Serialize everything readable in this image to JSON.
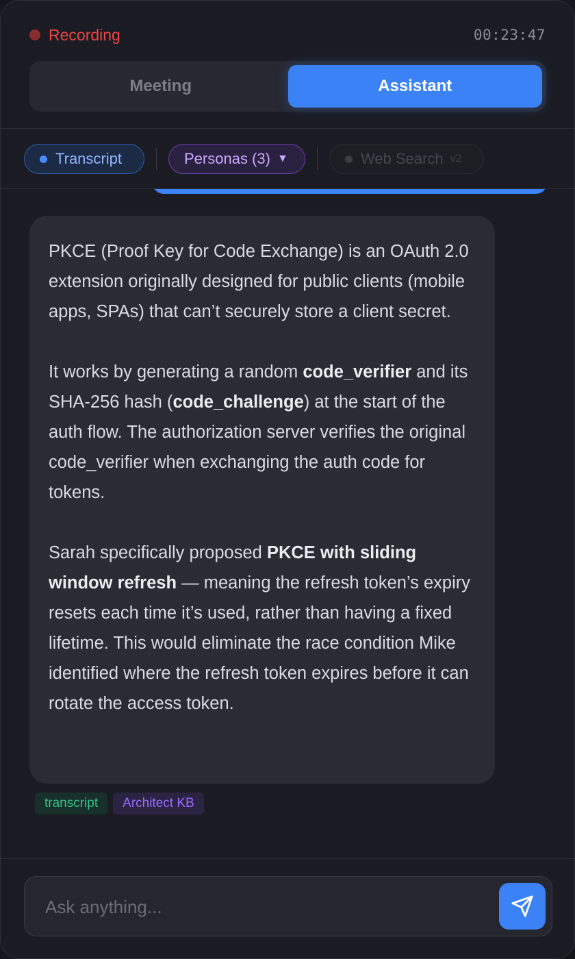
{
  "header": {
    "status_label": "Recording",
    "timer": "00:23:47"
  },
  "tabs": [
    {
      "label": "Meeting",
      "active": false
    },
    {
      "label": "Assistant",
      "active": true
    }
  ],
  "filters": {
    "transcript": "Transcript",
    "personas": "Personas (3)",
    "web_search": "Web Search",
    "web_search_version": "v2"
  },
  "message": {
    "p1": "PKCE (Proof Key for Code Exchange) is an OAuth 2.0 extension originally designed for public clients (mobile apps, SPAs) that can’t securely store a client secret.",
    "p2_a": "It works by generating a random ",
    "p2_b": "code_verifier",
    "p2_c": " and its SHA-256 hash (",
    "p2_d": "code_challenge",
    "p2_e": ") at the start of the auth flow. The authorization server verifies the original code_verifier when exchanging the auth code for tokens.",
    "p3_a": "Sarah specifically proposed ",
    "p3_b": "PKCE with sliding window refresh",
    "p3_c": " — meaning the refresh token’s expiry resets each time it’s used, rather than having a fixed lifetime. This would eliminate the race condition Mike identified where the refresh token expires before it can rotate the access token."
  },
  "sources": [
    "transcript",
    "Architect KB"
  ],
  "composer": {
    "placeholder": "Ask anything...",
    "value": ""
  },
  "colors": {
    "accent": "#3b82f6",
    "recording": "#ef4444",
    "transcript_source": "#34c38a",
    "kb_source": "#9d6bff"
  },
  "icons": {
    "send": "send-icon",
    "recording": "recording-dot-icon"
  }
}
